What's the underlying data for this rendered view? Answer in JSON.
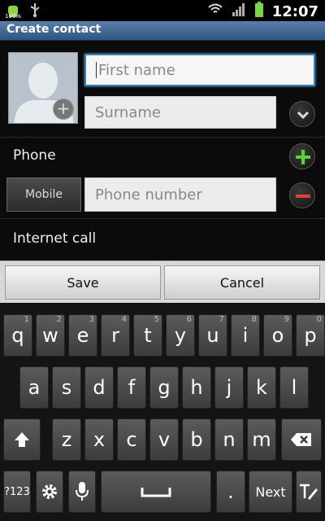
{
  "status_bar": {
    "battery_left_label": "100%",
    "time": "12:07"
  },
  "app": {
    "title": "Create contact"
  },
  "form": {
    "first_name_placeholder": "First name",
    "surname_placeholder": "Surname",
    "phone_section_label": "Phone",
    "phone_type_label": "Mobile",
    "phone_placeholder": "Phone number",
    "internet_call_label": "Internet call"
  },
  "actions": {
    "save": "Save",
    "cancel": "Cancel"
  },
  "keyboard": {
    "row1": [
      {
        "label": "q",
        "hint": "1"
      },
      {
        "label": "w",
        "hint": "2"
      },
      {
        "label": "e",
        "hint": "3"
      },
      {
        "label": "r",
        "hint": "4"
      },
      {
        "label": "t",
        "hint": "5"
      },
      {
        "label": "y",
        "hint": "6"
      },
      {
        "label": "u",
        "hint": "7"
      },
      {
        "label": "i",
        "hint": "8"
      },
      {
        "label": "o",
        "hint": "9"
      },
      {
        "label": "p",
        "hint": "0"
      }
    ],
    "row2": [
      "a",
      "s",
      "d",
      "f",
      "g",
      "h",
      "j",
      "k",
      "l"
    ],
    "row3": [
      "z",
      "x",
      "c",
      "v",
      "b",
      "n",
      "m"
    ],
    "sym_label": "?123",
    "dot_label": ".",
    "next_label": "Next"
  },
  "colors": {
    "title_bar": "#2f5583",
    "focus_border": "#3a7fb0",
    "add_green": "#5fcf3a",
    "remove_red": "#e0432e"
  },
  "icons": {
    "status": [
      "android-notification-icon",
      "usb-icon",
      "wifi-icon",
      "signal-icon",
      "battery-icon"
    ],
    "avatar": "contact-silhouette-icon",
    "expand": "chevron-down-icon",
    "add_phone": "plus-icon",
    "remove_phone": "minus-icon",
    "shift": "shift-icon",
    "backspace": "backspace-icon",
    "settings": "gear-icon",
    "voice": "microphone-icon",
    "space": "space-icon",
    "handwriting": "handwriting-icon"
  }
}
